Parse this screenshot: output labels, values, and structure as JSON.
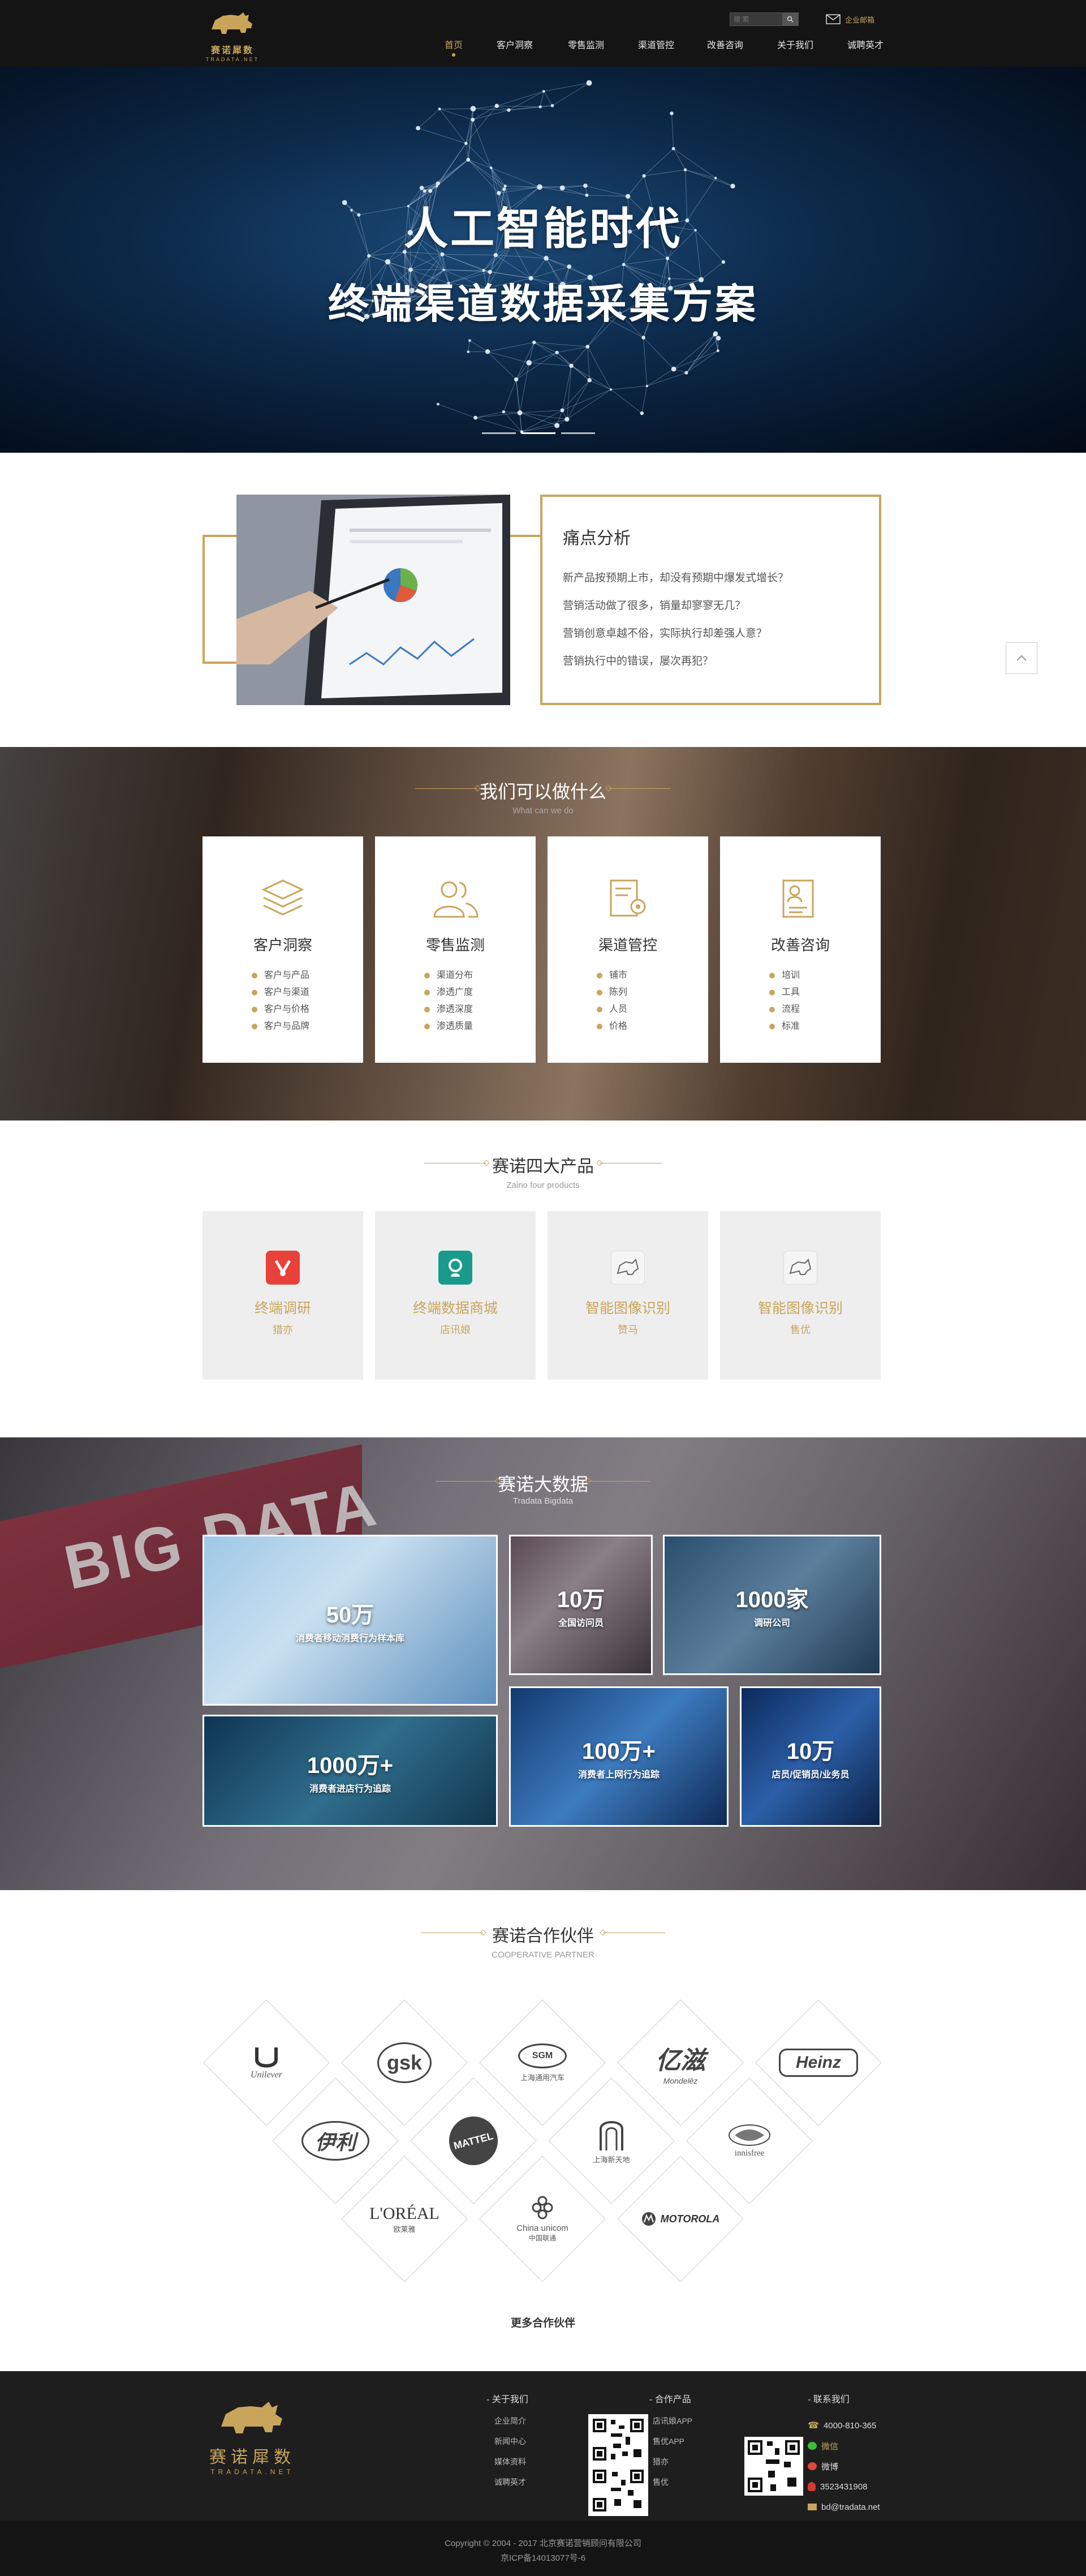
{
  "header": {
    "logo_text": "赛诺犀数",
    "logo_text_en": "TRADATA.NET",
    "search_placeholder": "搜 索",
    "mail_label": "企业邮箱",
    "nav": [
      {
        "label": "首页",
        "active": true
      },
      {
        "label": "客户洞察"
      },
      {
        "label": "零售监测"
      },
      {
        "label": "渠道管控"
      },
      {
        "label": "改善咨询"
      },
      {
        "label": "关于我们"
      },
      {
        "label": "诚聘英才"
      }
    ]
  },
  "hero": {
    "title_line1": "人工智能时代",
    "title_line2": "终端渠道数据采集方案",
    "slides": 3,
    "active_slide": 2
  },
  "pain": {
    "title": "痛点分析",
    "items": [
      "新产品按预期上市，却没有预期中爆发式增长？",
      "营销活动做了很多，销量却寥寥无几？",
      "营销创意卓越不俗，实际执行却差强人意？",
      "营销执行中的错误，屡次再犯？"
    ]
  },
  "services": {
    "title": "我们可以做什么",
    "subtitle": "What can we do",
    "cards": [
      {
        "title": "客户洞察",
        "icon": "layers-icon",
        "items": [
          "客户与产品",
          "客户与渠道",
          "客户与价格",
          "客户与品牌"
        ]
      },
      {
        "title": "零售监测",
        "icon": "people-icon",
        "items": [
          "渠道分布",
          "渗透广度",
          "渗透深度",
          "渗透质量"
        ]
      },
      {
        "title": "渠道管控",
        "icon": "document-gear-icon",
        "items": [
          "铺市",
          "陈列",
          "人员",
          "价格"
        ]
      },
      {
        "title": "改善咨询",
        "icon": "clipboard-person-icon",
        "items": [
          "培训",
          "工具",
          "流程",
          "标准"
        ]
      }
    ]
  },
  "products": {
    "title": "赛诺四大产品",
    "subtitle": "Zaino four products",
    "cards": [
      {
        "name": "终端调研",
        "sub": "猎亦",
        "icon": "survey-app-icon",
        "color": "#e8413a"
      },
      {
        "name": "终端数据商城",
        "sub": "店讯娘",
        "icon": "store-app-icon",
        "color": "#1a9a8c"
      },
      {
        "name": "智能图像识别",
        "sub": "赞马",
        "icon": "rhino-app-icon",
        "color": "#f2f2f2"
      },
      {
        "name": "智能图像识别",
        "sub": "售优",
        "icon": "rhino-app-icon",
        "color": "#f2f2f2"
      }
    ]
  },
  "bigdata": {
    "bg_text": "BIG DATA",
    "title": "赛诺大数据",
    "subtitle": "Tradata Bigdata",
    "tiles": [
      {
        "num": "50万",
        "label": "消费者移动消费行为样本库"
      },
      {
        "num": "10万",
        "label": "全国访问员"
      },
      {
        "num": "1000家",
        "label": "调研公司"
      },
      {
        "num": "1000万+",
        "label": "消费者进店行为追踪"
      },
      {
        "num": "100万+",
        "label": "消费者上网行为追踪"
      },
      {
        "num": "10万",
        "label": "店员/促销员/业务员"
      }
    ]
  },
  "partners": {
    "title": "赛诺合作伙伴",
    "subtitle": "COOPERATIVE PARTNER",
    "logos": [
      {
        "name": "Unilever",
        "sub": ""
      },
      {
        "name": "gsk",
        "sub": ""
      },
      {
        "name": "SGM",
        "sub": "上海通用汽车"
      },
      {
        "name": "亿滋",
        "sub": "Mondelēz"
      },
      {
        "name": "Heinz",
        "sub": ""
      },
      {
        "name": "伊利",
        "sub": ""
      },
      {
        "name": "MATTEL",
        "sub": ""
      },
      {
        "name": "上海新天地",
        "sub": ""
      },
      {
        "name": "innisfree",
        "sub": ""
      },
      {
        "name": "L'ORÉAL",
        "sub": "欧莱雅"
      },
      {
        "name": "China unicom",
        "sub": "中国联通"
      },
      {
        "name": "MOTOROLA",
        "sub": ""
      }
    ],
    "more_label": "更多合作伙伴"
  },
  "footer": {
    "logo_text": "赛诺犀数",
    "logo_text_en": "TRADATA.NET",
    "about_head": "- 关于我们",
    "about_links": [
      "企业简介",
      "新闻中心",
      "媒体资料",
      "诚聘英才"
    ],
    "products_head": "- 合作产品",
    "products_links": [
      "店讯娘APP",
      "售优APP",
      "猎亦",
      "售优"
    ],
    "contact_head": "- 联系我们",
    "contact": [
      {
        "icon": "phone-icon",
        "text": "4000-810-365"
      },
      {
        "icon": "wechat-icon",
        "text": "微信"
      },
      {
        "icon": "weibo-icon",
        "text": "微博"
      },
      {
        "icon": "qq-icon",
        "text": "3523431908"
      },
      {
        "icon": "mail-icon",
        "text": "bd@tradata.net"
      }
    ],
    "copyright": "Copyright © 2004 - 2017 北京赛诺营销顾问有限公司",
    "icp": "京ICP备14013077号-6"
  },
  "colors": {
    "accent": "#c9a55c",
    "header_bg": "#141414",
    "footer_bg": "#1e1e1e"
  }
}
